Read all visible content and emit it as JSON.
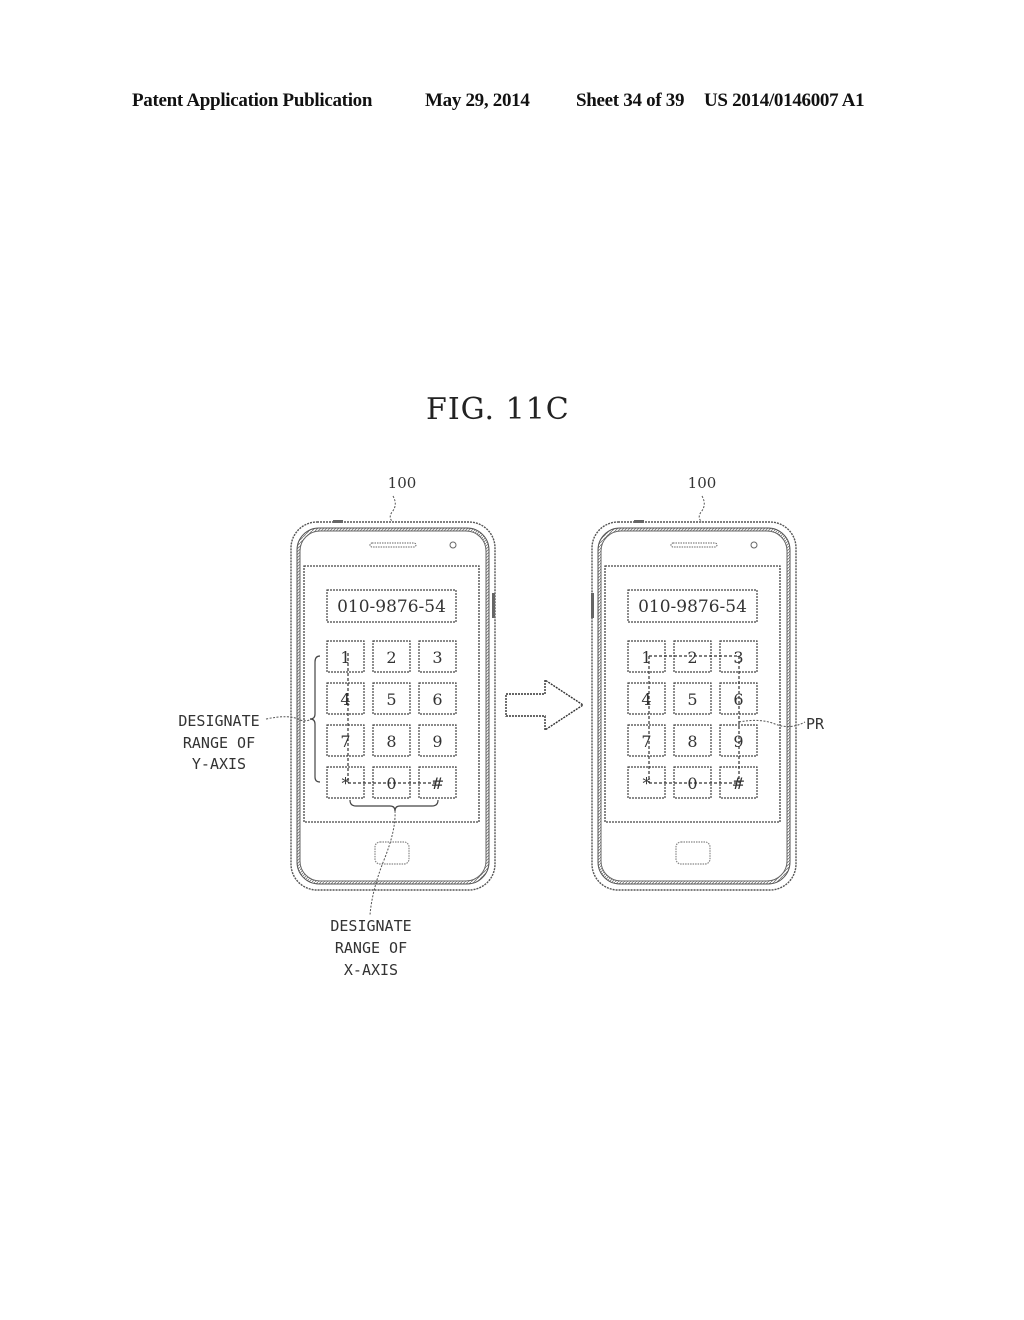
{
  "header": {
    "left": "Patent Application Publication",
    "date": "May 29, 2014",
    "sheet": "Sheet 34 of 39",
    "number": "US 2014/0146007 A1"
  },
  "figure": {
    "title": "FIG. 11C",
    "devices": [
      {
        "ref": "100",
        "display": "010-9876-54",
        "keys": [
          "1",
          "2",
          "3",
          "4",
          "5",
          "6",
          "7",
          "8",
          "9",
          "*",
          "0",
          "#"
        ],
        "annotations": {
          "y_axis": [
            "DESIGNATE",
            "RANGE OF",
            "Y-AXIS"
          ],
          "x_axis": [
            "DESIGNATE",
            "RANGE OF",
            "X-AXIS"
          ]
        }
      },
      {
        "ref": "100",
        "display": "010-9876-54",
        "keys": [
          "1",
          "2",
          "3",
          "4",
          "5",
          "6",
          "7",
          "8",
          "9",
          "*",
          "0",
          "#"
        ],
        "annotations": {
          "pattern_ref": "PR"
        }
      }
    ],
    "transition": "arrow-right"
  }
}
